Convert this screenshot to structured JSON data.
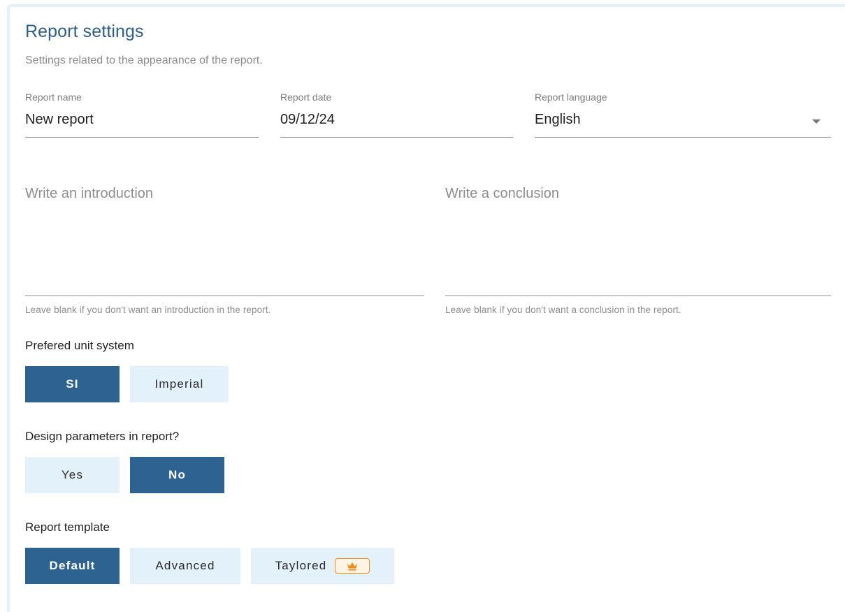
{
  "header": {
    "title": "Report settings",
    "subtitle": "Settings related to the appearance of the report."
  },
  "fields": {
    "report_name": {
      "label": "Report name",
      "value": "New report"
    },
    "report_date": {
      "label": "Report date",
      "value": "09/12/24"
    },
    "report_language": {
      "label": "Report language",
      "value": "English"
    }
  },
  "introduction": {
    "placeholder": "Write an introduction",
    "hint": "Leave blank if you don't want an introduction in the report."
  },
  "conclusion": {
    "placeholder": "Write a conclusion",
    "hint": "Leave blank if you don't want a conclusion in the report."
  },
  "unit_system": {
    "label": "Prefered unit system",
    "options": [
      "SI",
      "Imperial"
    ],
    "selected": "SI"
  },
  "design_parameters": {
    "label": "Design parameters in report?",
    "options": [
      "Yes",
      "No"
    ],
    "selected": "No"
  },
  "template": {
    "label": "Report template",
    "options": [
      "Default",
      "Advanced",
      "Taylored"
    ],
    "selected": "Default",
    "premium_icon": "crown-icon"
  },
  "colors": {
    "accent": "#2e6290",
    "inactive_button": "#e3f1fb",
    "title": "#2e5f8a",
    "premium": "#f08a1c"
  }
}
